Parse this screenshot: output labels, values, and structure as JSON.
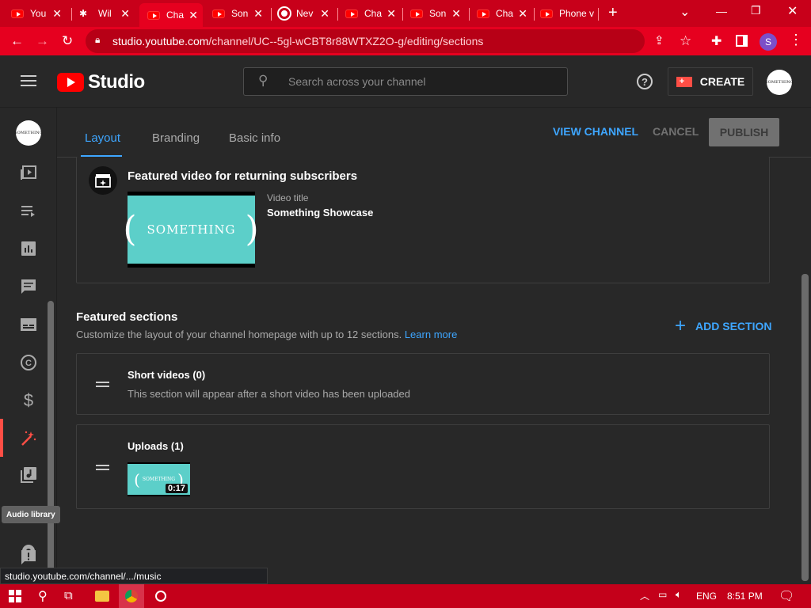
{
  "browser": {
    "tabs": [
      {
        "label": "You",
        "icon": "youtube-icon"
      },
      {
        "label": "Wil",
        "icon": "site-icon"
      },
      {
        "label": "Cha",
        "icon": "youtube-icon",
        "active": true
      },
      {
        "label": "Son",
        "icon": "youtube-icon"
      },
      {
        "label": "Nev",
        "icon": "chrome-icon"
      },
      {
        "label": "Cha",
        "icon": "youtube-icon"
      },
      {
        "label": "Son",
        "icon": "youtube-icon"
      },
      {
        "label": "Cha",
        "icon": "youtube-icon"
      },
      {
        "label": "Phone v",
        "icon": "youtube-icon"
      }
    ],
    "url_host": "studio.youtube.com",
    "url_path": "/channel/UC--5gl-wCBT8r88WTXZ2O-g/editing/sections",
    "profile_initial": "S"
  },
  "studio": {
    "logo_text": "Studio",
    "search_placeholder": "Search across your channel",
    "create_label": "CREATE",
    "avatar_text": "SOMETHING"
  },
  "editor": {
    "tabs": [
      "Layout",
      "Branding",
      "Basic info"
    ],
    "active_tab": "Layout",
    "view_channel": "VIEW CHANNEL",
    "cancel": "CANCEL",
    "publish": "PUBLISH",
    "featured_video": {
      "heading": "Featured video for returning subscribers",
      "video_title_label": "Video title",
      "video_title": "Something Showcase",
      "thumb_text": "SOMETHING"
    },
    "featured_sections": {
      "heading": "Featured sections",
      "description": "Customize the layout of your channel homepage with up to 12 sections.",
      "learn_more": "Learn more",
      "add_section": "ADD SECTION"
    },
    "sections": [
      {
        "title": "Short videos (0)",
        "subtitle": "This section will appear after a short video has been uploaded"
      },
      {
        "title": "Uploads (1)",
        "duration": "0:17",
        "thumb_text": "SOMETHING"
      }
    ]
  },
  "sidebar_tooltip": "Audio library",
  "status_url": "studio.youtube.com/channel/.../music",
  "taskbar": {
    "language": "ENG",
    "time": "8:51 PM"
  },
  "colors": {
    "accent_blue": "#3ea6ff",
    "brand_red": "#ff0000",
    "chrome_red": "#e6001f",
    "thumb_teal": "#5ccfc9"
  }
}
